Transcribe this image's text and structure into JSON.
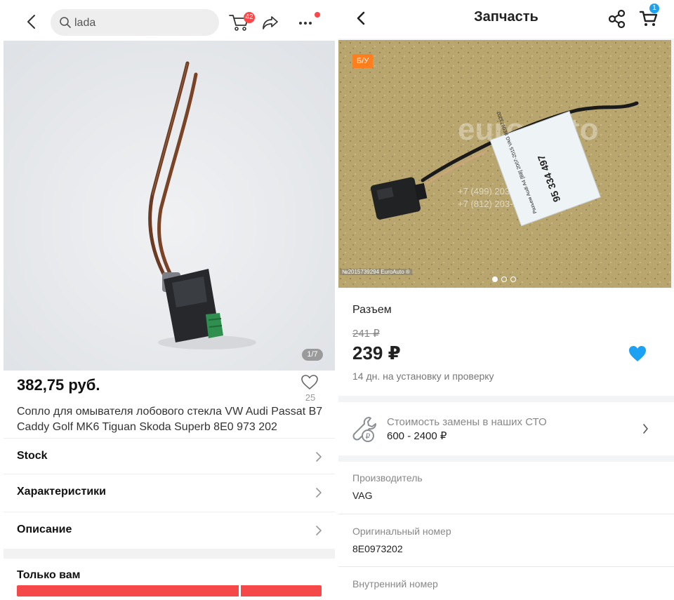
{
  "left": {
    "search": {
      "value": "lada"
    },
    "cart_badge": "42",
    "image_counter": "1/7",
    "price": "382,75 руб.",
    "likes": "25",
    "title": "Сопло для омывателя лобового стекла VW Audi Passat B7 Caddy Golf MK6 Tiguan Skoda Superb 8E0 973 202",
    "rows": [
      {
        "label": "Stock"
      },
      {
        "label": "Характеристики"
      },
      {
        "label": "Описание"
      }
    ],
    "section_title": "Только вам",
    "accent_color": "#ff4747"
  },
  "right": {
    "header": {
      "title": "Запчасть"
    },
    "cart_badge": "1",
    "image": {
      "tag": "Б/У",
      "watermark": "№2015739294 EuroAuto ®",
      "label_number": "95 334 497",
      "label_text": "Разъем Audi A4 [B8] 2007-2015 VAG 8E0973202",
      "logo_text": "euro auto",
      "phones": [
        "+7 (499) 203-13-36",
        "+7 (812) 203-13-36"
      ],
      "slide_count": 3,
      "active_slide": 0
    },
    "product": {
      "name": "Разъем",
      "old_price": "241 ₽",
      "price": "239 ₽",
      "install_note": "14 дн. на установку и проверку"
    },
    "service": {
      "label": "Стоимость замены в наших СТО",
      "value": "600 - 2400 ₽"
    },
    "specs": [
      {
        "label": "Производитель",
        "value": "VAG"
      },
      {
        "label": "Оригинальный номер",
        "value": "8E0973202"
      },
      {
        "label": "Внутренний номер",
        "value": ""
      }
    ],
    "accent_color": "#1da1f2",
    "tag_color": "#ff7f1f"
  }
}
